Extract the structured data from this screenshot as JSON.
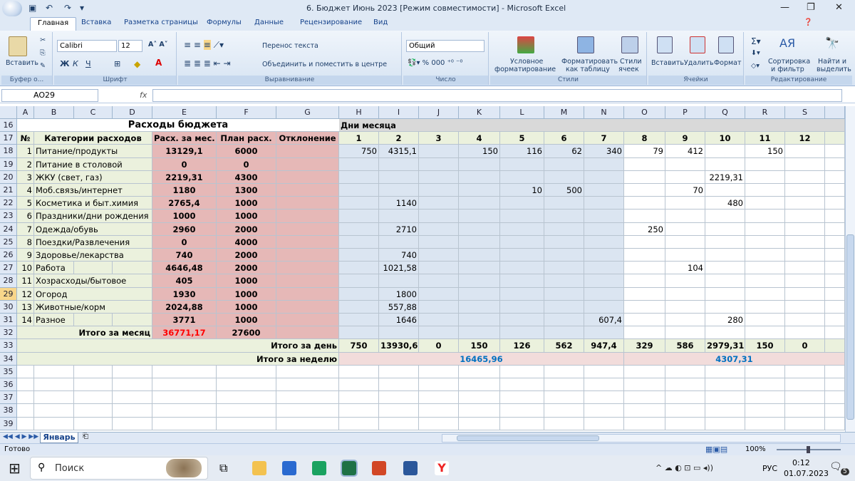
{
  "window": {
    "title": "6.  Бюджет Июнь 2023  [Режим совместимости] - Microsoft Excel"
  },
  "tabs": [
    "Главная",
    "Вставка",
    "Разметка страницы",
    "Формулы",
    "Данные",
    "Рецензирование",
    "Вид"
  ],
  "ribbon": {
    "paste": "Вставить",
    "clipboard": "Буфер о...",
    "font_name": "Calibri",
    "font_size": "12",
    "font_group": "Шрифт",
    "wrap": "Перенос текста",
    "merge": "Объединить и поместить в центре",
    "align_group": "Выравнивание",
    "number_format": "Общий",
    "number_group": "Число",
    "cond_fmt": "Условное",
    "cond_fmt2": "форматирование",
    "fmt_table": "Форматировать",
    "fmt_table2": "как таблицу",
    "styles_btn": "Стили",
    "styles_btn2": "ячеек",
    "styles_group": "Стили",
    "insert": "Вставить",
    "delete": "Удалить",
    "format": "Формат",
    "cells_group": "Ячейки",
    "sort": "Сортировка",
    "sort2": "и фильтр",
    "find": "Найти и",
    "find2": "выделить",
    "edit_group": "Редактирование"
  },
  "namebox": "AO29",
  "formula": "",
  "columns": [
    "A",
    "B",
    "C",
    "D",
    "E",
    "F",
    "G",
    "H",
    "I",
    "J",
    "K",
    "L",
    "M",
    "N",
    "O",
    "P",
    "Q",
    "R",
    "S"
  ],
  "rows": [
    {
      "n": "16",
      "cells": {
        "E": "Расходы бюджета",
        "H": "Дни месяца"
      }
    },
    {
      "n": "17",
      "cells": {
        "A": "№",
        "B": "Категории расходов",
        "E": "Расх. за мес.",
        "F": "План расх.",
        "G": "Отклонение",
        "H": "1",
        "I": "2",
        "J": "3",
        "K": "4",
        "L": "5",
        "M": "6",
        "N": "7",
        "O": "8",
        "P": "9",
        "Q": "10",
        "R": "11",
        "S": "12"
      }
    },
    {
      "n": "18",
      "cells": {
        "A": "1",
        "B": "Питание/продукты",
        "E": "13129,1",
        "F": "6000",
        "H": "750",
        "I": "4315,1",
        "K": "150",
        "L": "116",
        "M": "62",
        "N": "340",
        "O": "79",
        "P": "412",
        "R": "150"
      }
    },
    {
      "n": "19",
      "cells": {
        "A": "2",
        "B": "Питание в столовой",
        "E": "0",
        "F": "0"
      }
    },
    {
      "n": "20",
      "cells": {
        "A": "3",
        "B": "ЖКУ (свет, газ)",
        "E": "2219,31",
        "F": "4300",
        "Q": "2219,31"
      }
    },
    {
      "n": "21",
      "cells": {
        "A": "4",
        "B": "Моб.связь/интернет",
        "E": "1180",
        "F": "1300",
        "L": "10",
        "M": "500",
        "P": "70"
      }
    },
    {
      "n": "22",
      "cells": {
        "A": "5",
        "B": "Косметика и быт.химия",
        "E": "2765,4",
        "F": "1000",
        "I": "1140",
        "Q": "480"
      }
    },
    {
      "n": "23",
      "cells": {
        "A": "6",
        "B": "Праздники/дни рождения",
        "E": "1000",
        "F": "1000"
      }
    },
    {
      "n": "24",
      "cells": {
        "A": "7",
        "B": "Одежда/обувь",
        "E": "2960",
        "F": "2000",
        "I": "2710",
        "O": "250"
      }
    },
    {
      "n": "25",
      "cells": {
        "A": "8",
        "B": "Поездки/Развлечения",
        "E": "0",
        "F": "4000"
      }
    },
    {
      "n": "26",
      "cells": {
        "A": "9",
        "B": "Здоровье/лекарства",
        "E": "740",
        "F": "2000",
        "I": "740"
      }
    },
    {
      "n": "27",
      "cells": {
        "A": "10",
        "B": "Работа",
        "E": "4646,48",
        "F": "2000",
        "I": "1021,58",
        "P": "104"
      }
    },
    {
      "n": "28",
      "cells": {
        "A": "11",
        "B": "Хозрасходы/бытовое",
        "E": "405",
        "F": "1000"
      }
    },
    {
      "n": "29",
      "cells": {
        "A": "12",
        "B": "Огород",
        "E": "1930",
        "F": "1000",
        "I": "1800"
      }
    },
    {
      "n": "30",
      "cells": {
        "A": "13",
        "B": "Животные/корм",
        "E": "2024,88",
        "F": "1000",
        "I": "557,88"
      }
    },
    {
      "n": "31",
      "cells": {
        "A": "14",
        "B": "Разное",
        "E": "3771",
        "F": "1000",
        "I": "1646",
        "N": "607,4",
        "Q": "280"
      }
    },
    {
      "n": "32",
      "cells": {
        "C": "Итого за месяц",
        "E": "36771,17",
        "F": "27600"
      }
    },
    {
      "n": "33",
      "cells": {
        "G": "Итого за день",
        "H": "750",
        "I": "13930,6",
        "J": "0",
        "K": "150",
        "L": "126",
        "M": "562",
        "N": "947,4",
        "O": "329",
        "P": "586",
        "Q": "2979,31",
        "R": "150",
        "S": "0"
      }
    },
    {
      "n": "34",
      "cells": {
        "G": "Итого за неделю",
        "week1": "16465,96",
        "week2": "4307,31"
      }
    },
    {
      "n": "35",
      "cells": {}
    },
    {
      "n": "36",
      "cells": {}
    },
    {
      "n": "37",
      "cells": {}
    },
    {
      "n": "38",
      "cells": {}
    },
    {
      "n": "39",
      "cells": {}
    }
  ],
  "sheet_tab": "Январь",
  "status": {
    "ready": "Готово",
    "zoom": "100%"
  },
  "taskbar": {
    "search": "Поиск",
    "lang": "РУС",
    "time": "0:12",
    "date": "01.07.2023",
    "notif": "5"
  },
  "colors": {
    "green": "#ebf1dd",
    "pink": "#e6b8b7",
    "blue": "#dbe5f1",
    "rowhdr": "#dfe8f5",
    "red_total": "#ff0000",
    "week_blue": "#0070c0"
  }
}
